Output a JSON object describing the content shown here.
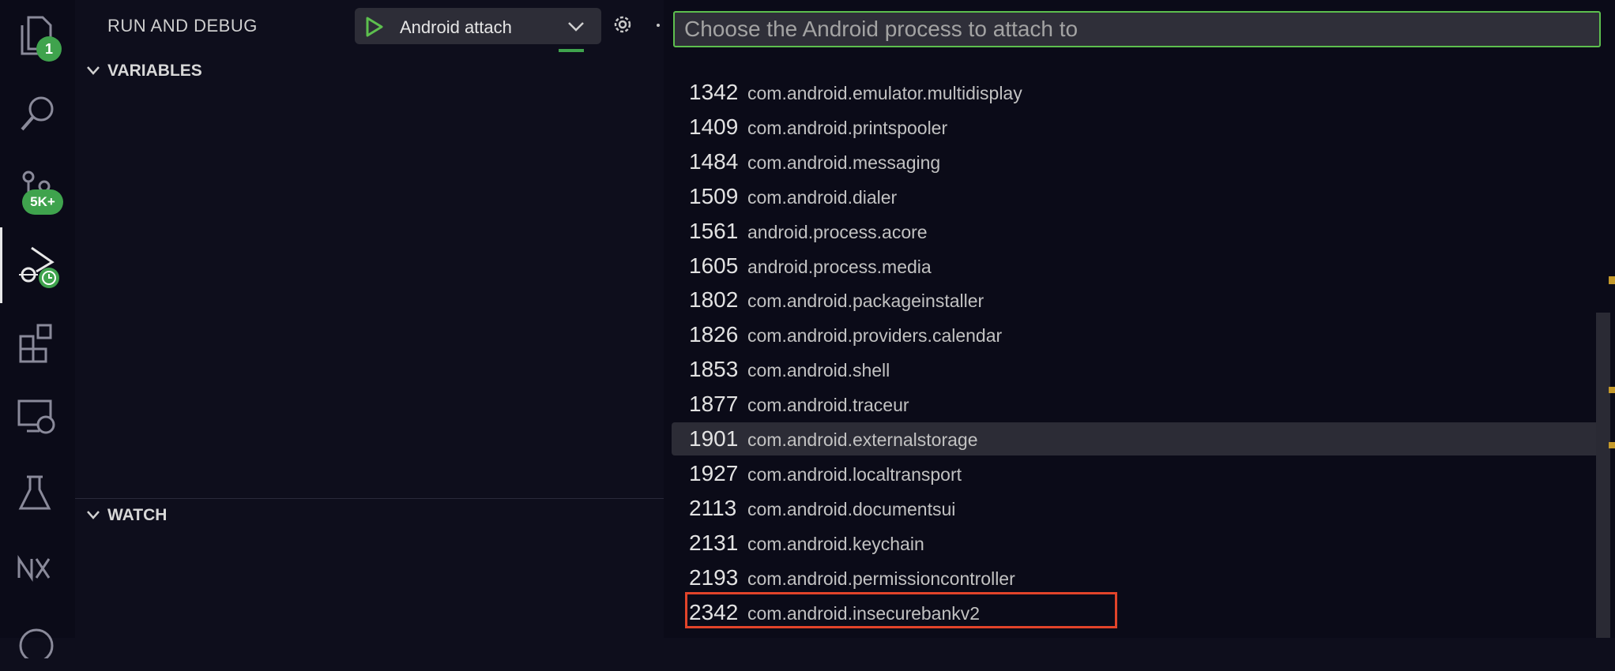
{
  "activity_bar": {
    "explorer_badge": "1",
    "scm_badge": "5K+"
  },
  "sidebar": {
    "title": "RUN AND DEBUG",
    "config_label": "Android attach",
    "sections": {
      "variables": "VARIABLES",
      "watch": "WATCH"
    }
  },
  "quickpick": {
    "placeholder": "Choose the Android process to attach to",
    "processes": [
      {
        "pid": "1342",
        "name": "com.android.emulator.multidisplay"
      },
      {
        "pid": "1409",
        "name": "com.android.printspooler"
      },
      {
        "pid": "1484",
        "name": "com.android.messaging"
      },
      {
        "pid": "1509",
        "name": "com.android.dialer"
      },
      {
        "pid": "1561",
        "name": "android.process.acore"
      },
      {
        "pid": "1605",
        "name": "android.process.media"
      },
      {
        "pid": "1802",
        "name": "com.android.packageinstaller"
      },
      {
        "pid": "1826",
        "name": "com.android.providers.calendar"
      },
      {
        "pid": "1853",
        "name": "com.android.shell"
      },
      {
        "pid": "1877",
        "name": "com.android.traceur"
      },
      {
        "pid": "1901",
        "name": "com.android.externalstorage"
      },
      {
        "pid": "1927",
        "name": "com.android.localtransport"
      },
      {
        "pid": "2113",
        "name": "com.android.documentsui"
      },
      {
        "pid": "2131",
        "name": "com.android.keychain"
      },
      {
        "pid": "2193",
        "name": "com.android.permissioncontroller"
      },
      {
        "pid": "2342",
        "name": "com.android.insecurebankv2"
      }
    ],
    "focused_index": 10,
    "highlighted_index": 15
  },
  "colors": {
    "accent": "#3fa34d",
    "input_border": "#5dbf4e",
    "highlight": "#e2442a"
  }
}
